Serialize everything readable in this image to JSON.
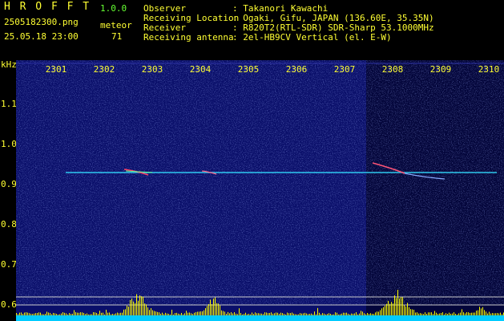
{
  "app": {
    "name": "H R O F F T",
    "version": "1.0.0"
  },
  "file": {
    "name": "2505182300.png",
    "datetime": "25.05.18 23:00"
  },
  "counter": {
    "label": "meteor",
    "value": "71"
  },
  "info": [
    {
      "key": "Observer",
      "value": ": Takanori Kawachi"
    },
    {
      "key": "Receiving Location",
      "value": ": Ogaki, Gifu, JAPAN (136.60E, 35.35N)"
    },
    {
      "key": "Receiver",
      "value": ": R820T2(RTL-SDR) SDR-Sharp 53.1000MHz"
    },
    {
      "key": "Receiving antenna",
      "value": ": 2el-HB9CV Vertical (el. E-W)"
    }
  ],
  "axis": {
    "unit": "kHz",
    "time_ticks": [
      "2301",
      "2302",
      "2303",
      "2304",
      "2305",
      "2306",
      "2307",
      "2308",
      "2309",
      "2310"
    ],
    "freq_ticks": [
      "1.1",
      "1.0",
      "0.9",
      "0.8",
      "0.7",
      "0.6"
    ]
  },
  "colors": {
    "background": "#000000",
    "header_text": "#ffff33",
    "header_accent": "#66ff33",
    "waterfall": "#0a0f6a",
    "carrier": "#33ddff",
    "bars": "#ffff00",
    "baseline": "#00ccff"
  }
}
